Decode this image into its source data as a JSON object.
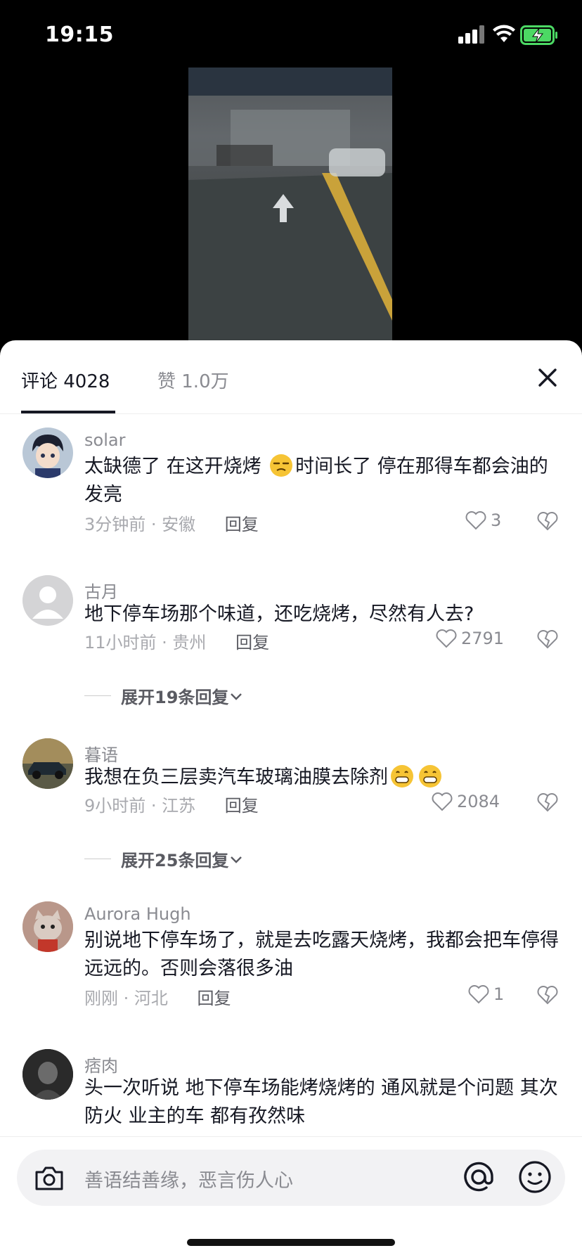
{
  "status": {
    "time": "19:15"
  },
  "tabs": {
    "comments": "评论 4028",
    "likes": "赞 1.0万"
  },
  "comments": [
    {
      "user": "solar",
      "text_a": "太缺德了 在这开烧烤 ",
      "text_b": "时间长了 停在那得车都会油的发亮",
      "time_loc": "3分钟前 · 安徽",
      "reply": "回复",
      "likes": "3"
    },
    {
      "user": "古月",
      "text": "地下停车场那个味道，还吃烧烤，尽然有人去?",
      "time_loc": "11小时前 · 贵州",
      "reply": "回复",
      "likes": "2791"
    },
    {
      "user": "暮语",
      "text": "我想在负三层卖汽车玻璃油膜去除剂",
      "time_loc": "9小时前 · 江苏",
      "reply": "回复",
      "likes": "2084"
    },
    {
      "user": "Aurora Hugh",
      "text": "别说地下停车场了，就是去吃露天烧烤，我都会把车停得远远的。否则会落很多油",
      "time_loc": "刚刚 · 河北",
      "reply": "回复",
      "likes": "1"
    },
    {
      "user": "痞肉",
      "text": "头一次听说 地下停车场能烤烧烤的 通风就是个问题 其次防火  业主的车 都有孜然味"
    }
  ],
  "expand": [
    "展开19条回复",
    "展开25条回复"
  ],
  "input": {
    "placeholder": "善语结善缘，恶言伤人心"
  },
  "icons": [
    "close-icon",
    "heart-icon",
    "dislike-icon",
    "camera-icon",
    "at-icon",
    "emoji-icon",
    "chevron-down-icon"
  ]
}
